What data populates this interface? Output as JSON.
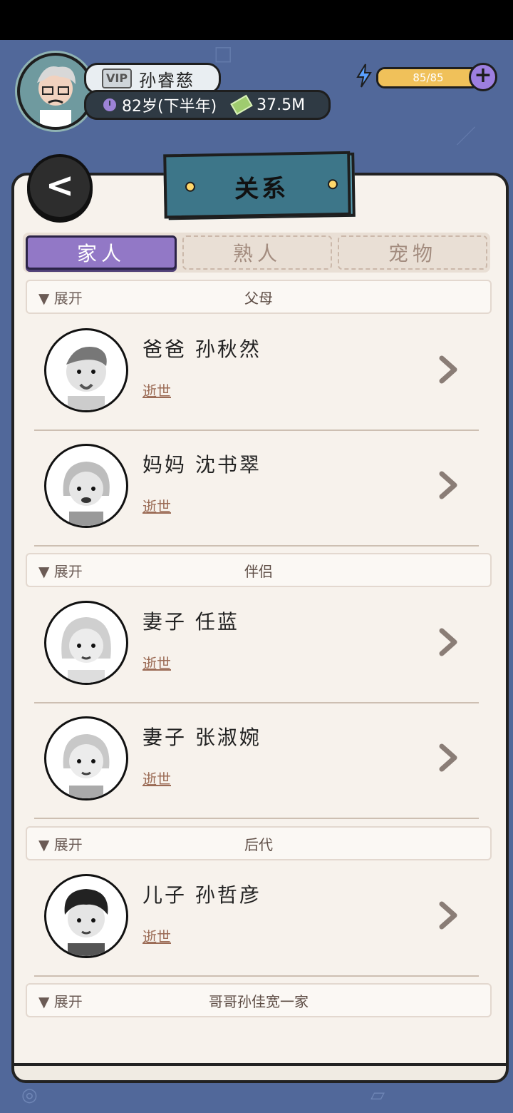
{
  "player": {
    "vip_label": "VIP",
    "name": "孙睿慈",
    "age": "82岁(下半年)",
    "money": "37.5M",
    "energy_text": "85/85",
    "energy_level": 1.0
  },
  "back_label": "<",
  "title": "关系",
  "tabs": [
    {
      "label": "家人"
    },
    {
      "label": "熟人"
    },
    {
      "label": "宠物"
    }
  ],
  "groups": [
    {
      "expand": "▼ 展开",
      "title": "父母"
    },
    {
      "expand": "▼ 展开",
      "title": "伴侣"
    },
    {
      "expand": "▼ 展开",
      "title": "后代"
    },
    {
      "expand": "▼ 展开",
      "title": "哥哥孙佳宽一家"
    }
  ],
  "people": [
    {
      "name": "爸爸  孙秋然",
      "status": "逝世"
    },
    {
      "name": "妈妈  沈书翠",
      "status": "逝世"
    },
    {
      "name": "妻子  任蓝",
      "status": "逝世"
    },
    {
      "name": "妻子  张淑婉",
      "status": "逝世"
    },
    {
      "name": "儿子  孙哲彦",
      "status": "逝世"
    }
  ],
  "colors": {
    "background": "#51689a",
    "panel": "#f7f2ec",
    "tab_active": "#9278c6",
    "title_banner": "#5aa0b4",
    "status_text": "#9b6b55"
  },
  "icons": [
    "clock-icon",
    "money-icon",
    "energy-icon",
    "plus-icon",
    "back-arrow-icon",
    "chevron-right-icon"
  ]
}
